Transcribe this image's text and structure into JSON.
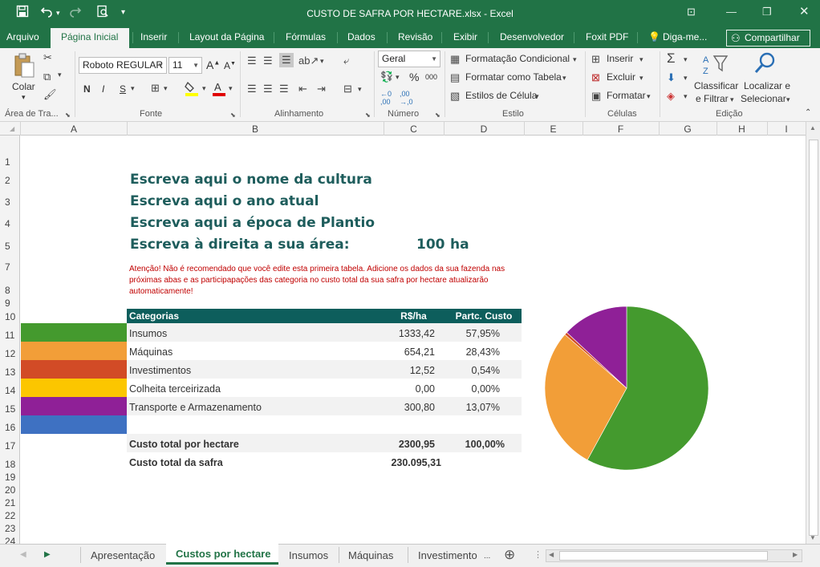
{
  "window": {
    "title": "CUSTO DE SAFRA POR HECTARE.xlsx - Excel",
    "quick_access": [
      "save-icon",
      "undo-icon",
      "redo-icon",
      "print-preview-icon",
      "customize-icon"
    ]
  },
  "ribbon_tabs": {
    "arquivo": "Arquivo",
    "pagina_inicial": "Página Inicial",
    "inserir": "Inserir",
    "layout": "Layout da Página",
    "formulas": "Fórmulas",
    "dados": "Dados",
    "revisao": "Revisão",
    "exibir": "Exibir",
    "desenvolvedor": "Desenvolvedor",
    "foxit": "Foxit PDF",
    "diga_me": "Diga-me...",
    "compartilhar": "Compartilhar"
  },
  "ribbon": {
    "clipboard": {
      "colar": "Colar",
      "label": "Área de Tra..."
    },
    "font": {
      "name": "Roboto REGULAR",
      "size": "11",
      "label": "Fonte",
      "bold": "N",
      "italic": "I",
      "underline": "S"
    },
    "alignment": {
      "label": "Alinhamento"
    },
    "number": {
      "format": "Geral",
      "label": "Número"
    },
    "styles": {
      "cond_format": "Formatação Condicional",
      "format_table": "Formatar como Tabela",
      "cell_styles": "Estilos de Célula",
      "label": "Estilo"
    },
    "cells": {
      "inserir": "Inserir",
      "excluir": "Excluir",
      "formatar": "Formatar",
      "label": "Células"
    },
    "editing": {
      "classificar_1": "Classificar",
      "classificar_2": "e Filtrar",
      "localizar_1": "Localizar e",
      "localizar_2": "Selecionar",
      "label": "Edição"
    }
  },
  "columns": [
    "A",
    "B",
    "C",
    "D",
    "E",
    "F",
    "G",
    "H",
    "I"
  ],
  "rows": [
    "1",
    "2",
    "3",
    "4",
    "5",
    "7",
    "8",
    "9",
    "10",
    "11",
    "12",
    "13",
    "14",
    "15",
    "16",
    "17",
    "18",
    "19",
    "20",
    "21",
    "22",
    "23",
    "24"
  ],
  "sheet": {
    "line_crop": "Escreva aqui o nome da cultura",
    "line_year": "Escreva aqui o ano atual",
    "line_season": "Escreva aqui a época de Plantio",
    "line_area": "Escreva à direita a sua área:",
    "area_value": "100",
    "area_unit": "ha",
    "warning": "Atenção! Não é recomendado que você edite esta primeira tabela. Adicione os dados da sua fazenda nas próximas abas e as participapações das categoria no custo total da sua safra por hectare atualizarão automaticamente!",
    "table": {
      "headers": {
        "category": "Categorias",
        "value": "R$/ha",
        "share": "Partc. Custo"
      },
      "rows": [
        {
          "category": "Insumos",
          "value": "1333,42",
          "share": "57,95%",
          "color": "#449a2e"
        },
        {
          "category": "Máquinas",
          "value": "654,21",
          "share": "28,43%",
          "color": "#f29e38"
        },
        {
          "category": "Investimentos",
          "value": "12,52",
          "share": "0,54%",
          "color": "#d24b26"
        },
        {
          "category": "Colheita terceirizada",
          "value": "0,00",
          "share": "0,00%",
          "color": "#fcc600"
        },
        {
          "category": "Transporte e Armazenamento",
          "value": "300,80",
          "share": "13,07%",
          "color": "#8f2097"
        }
      ],
      "blank_swatch_color": "#3e71c2",
      "total_ha_label": "Custo total por hectare",
      "total_ha_value": "2300,95",
      "total_ha_share": "100,00%",
      "total_safra_label": "Custo total da safra",
      "total_safra_value": "230.095,31"
    }
  },
  "chart_data": {
    "type": "pie",
    "categories": [
      "Insumos",
      "Máquinas",
      "Investimentos",
      "Colheita terceirizada",
      "Transporte e Armazenamento"
    ],
    "values": [
      57.95,
      28.43,
      0.54,
      0.0,
      13.07
    ],
    "colors": [
      "#449a2e",
      "#f29e38",
      "#d24b26",
      "#fcc600",
      "#8f2097"
    ],
    "title": ""
  },
  "sheet_tabs": {
    "items": [
      "Apresentação",
      "Custos por hectare",
      "Insumos",
      "Máquinas",
      "Investimento"
    ],
    "active": "Custos por hectare"
  },
  "colors": {
    "excel_green": "#217346",
    "heading_teal": "#1e5d5c",
    "table_header": "#0d5e5c",
    "warning_red": "#c00000"
  }
}
